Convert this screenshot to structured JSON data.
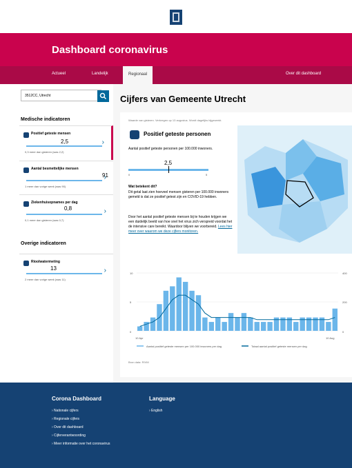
{
  "header": {
    "logo": "rijksoverheid-logo",
    "title": "Dashboard coronavirus"
  },
  "nav": {
    "items": [
      "Actueel",
      "Landelijk",
      "Regionaal",
      "Over dit dashboard"
    ],
    "active": "Regionaal"
  },
  "sidebar": {
    "search_value": "3512CC, Utrecht",
    "medical_title": "Medische indicatoren",
    "other_title": "Overige indicatoren",
    "cards": [
      {
        "label": "Positief geteste mensen",
        "value": "2,5",
        "change": "0,3 meer dan gisteren (was 2,2)",
        "icon": "person-icon"
      },
      {
        "label": "Aantal besmettelijke mensen",
        "value": "91",
        "change": "1 meer dan vorige week (was 90)",
        "icon": "virus-icon"
      },
      {
        "label": "Ziekenhuisopnames per dag",
        "value": "0,8",
        "change": "0,1 meer dan gisteren (was 0,7)",
        "icon": "hospital-icon"
      },
      {
        "label": "Rioolwatermeting",
        "value": "13",
        "change": "2 meer dan vorige week (was 11)",
        "icon": "sewer-icon"
      }
    ]
  },
  "main": {
    "title": "Cijfers van Gemeente Utrecht",
    "note": "Waarde van gisteren. Verkregen op 13 augustus. Wordt dagelijks bijgewerkt.",
    "panel_title": "Positief geteste personen",
    "desc": "Aantal positief geteste personen per 100.000 inwoners.",
    "value": "2,5",
    "value_fraction": 0.5,
    "tick_min": "0",
    "tick_max": "5",
    "question": "Wat betekent dit?",
    "answer1": "Dit getal laat zien hoeveel mensen gisteren per 100.000 inwoners gemeld is dat ze positief getest zijn en COVID-19 hebben.",
    "answer2": "Door het aantal positief geteste mensen bij te houden krijgen we een duidelijk beeld van hoe snel het virus zich verspreid voordat het de intensive care bereikt. Waardoor blijven we voorbereid.",
    "link": "Lees hier meer over waarom we deze cijfers monitoren.",
    "source": "Bron data: RIVM"
  },
  "chart_data": {
    "type": "bar",
    "x_start_label": "10 Apr",
    "x_end_label": "10 Aug",
    "ytick_left": [
      "0",
      "5",
      "10"
    ],
    "ytick_right": [
      "0",
      "200",
      "400"
    ],
    "values": [
      1,
      2,
      3,
      6,
      9,
      10,
      12,
      11,
      9,
      8,
      3,
      2,
      3,
      2,
      4,
      3,
      4,
      3,
      2,
      2,
      2,
      3,
      3,
      3,
      2,
      3,
      3,
      3,
      3,
      2,
      5
    ],
    "line_values": [
      1,
      1.5,
      2,
      3,
      5,
      7,
      8,
      8,
      7,
      6,
      4,
      3,
      3,
      3,
      3,
      3,
      3,
      3,
      2.5,
      2.5,
      2.5,
      2.5,
      2.5,
      2.5,
      2.5,
      2.5,
      2.5,
      2.5,
      2.5,
      2.5,
      3
    ],
    "legend": [
      "Aantal positief geteste mensen per 100.000 inwoners per dag",
      "Totaal aantal positief geteste mensen per dag"
    ],
    "bar_color": "#6bb6ea",
    "line_color": "#01689b"
  },
  "footer": {
    "col1_title": "Corona Dashboard",
    "col1_links": [
      "Nationale cijfers",
      "Regionale cijfers",
      "Over dit dashboard",
      "Cijferverantwoording",
      "Meer informatie over het coronavirus"
    ],
    "col2_title": "Language",
    "col2_links": [
      "English"
    ]
  },
  "colors": {
    "brand": "#c9034d",
    "nav": "#aa0a47",
    "footer": "#154273",
    "accent": "#01689b"
  }
}
